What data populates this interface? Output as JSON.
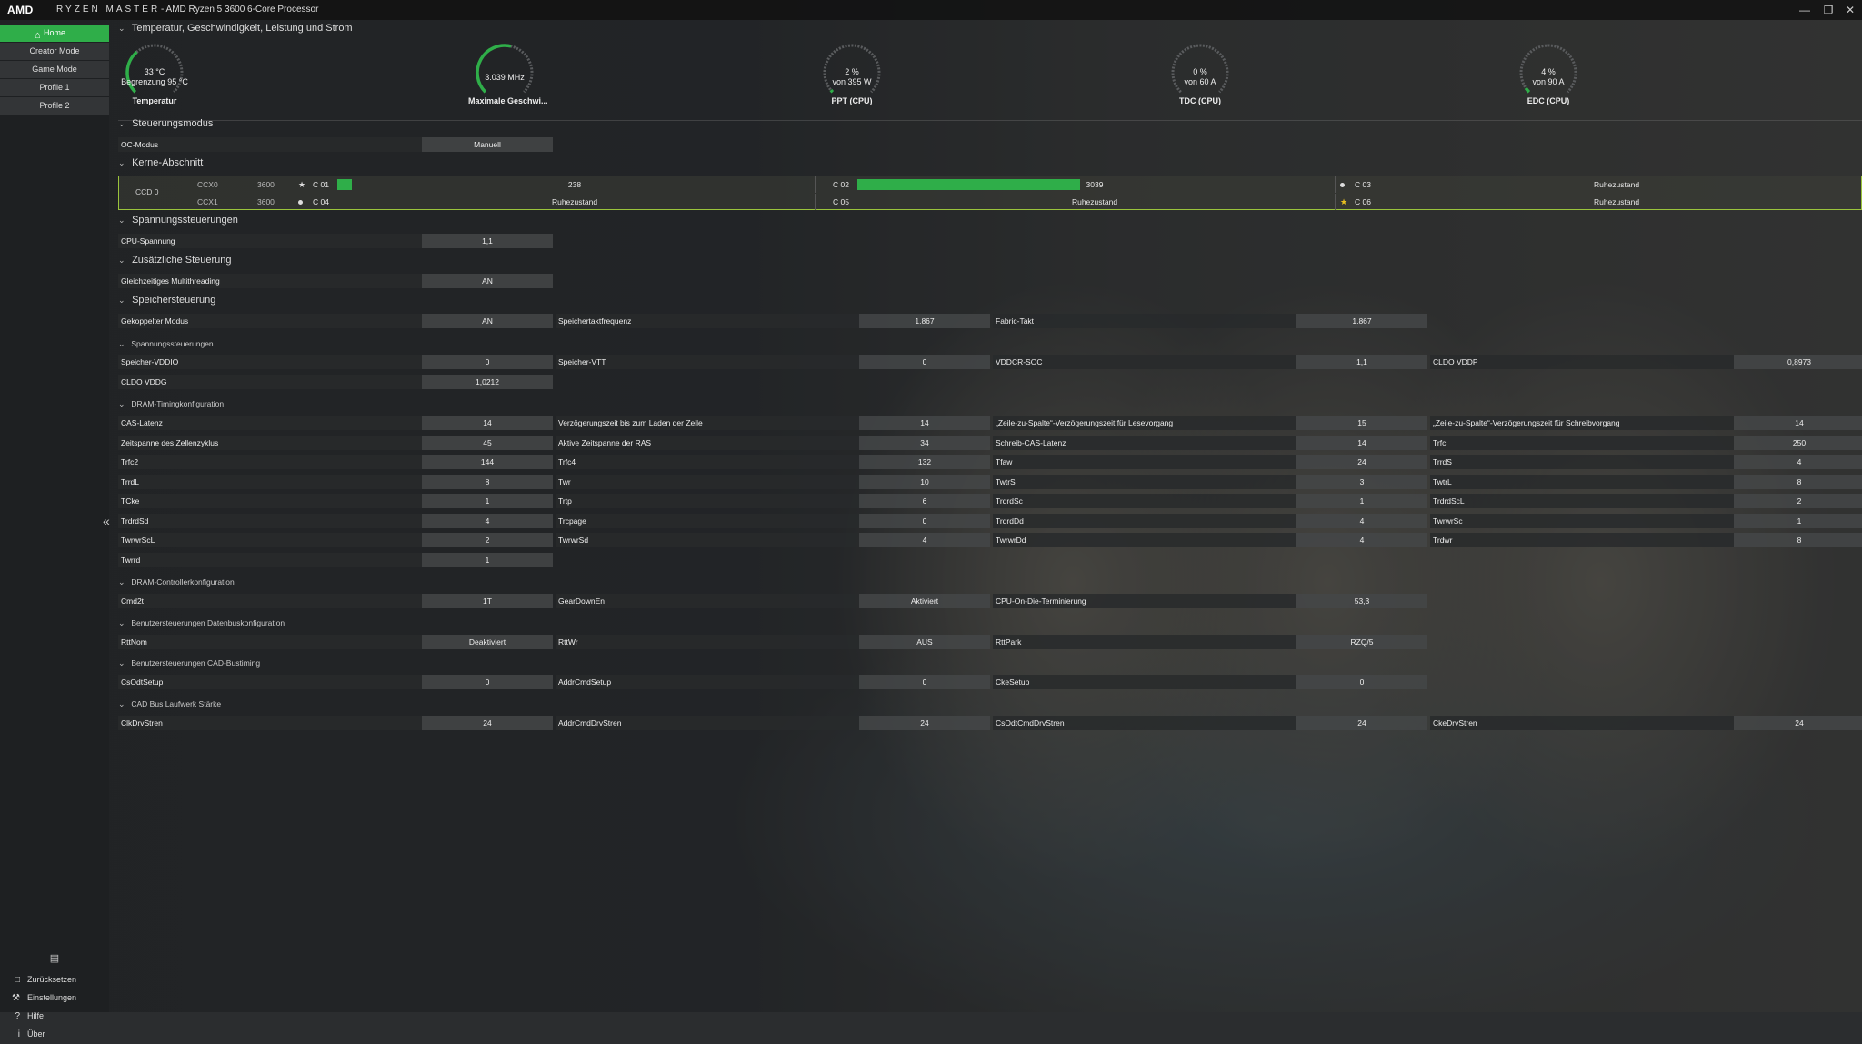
{
  "titlebar": {
    "brand": "AMD",
    "app": "RYZEN MASTER",
    "processor": "-  AMD Ryzen 5 3600 6-Core Processor"
  },
  "sidebar": {
    "items": [
      {
        "label": "Home"
      },
      {
        "label": "Creator Mode"
      },
      {
        "label": "Game Mode"
      },
      {
        "label": "Profile 1"
      },
      {
        "label": "Profile 2"
      }
    ],
    "bottom": [
      {
        "label": "Zurücksetzen"
      },
      {
        "label": "Einstellungen"
      },
      {
        "label": "Hilfe"
      },
      {
        "label": "Über"
      }
    ]
  },
  "sections": {
    "monitor": "Temperatur, Geschwindigkeit, Leistung und Strom",
    "control": "Steuerungsmodus",
    "cores": "Kerne-Abschnitt",
    "voltage": "Spannungssteuerungen",
    "additional": "Zusätzliche Steuerung",
    "memory": "Speichersteuerung",
    "mem_voltage": "Spannungssteuerungen",
    "dram_timing": "DRAM-Timingkonfiguration",
    "dram_ctrl": "DRAM-Controllerkonfiguration",
    "databus": "Benutzersteuerungen Datenbuskonfiguration",
    "cad_bus": "Benutzersteuerungen CAD-Bustiming",
    "cad_drive": "CAD Bus Laufwerk Stärke"
  },
  "gauges": [
    {
      "line1": "33 °C",
      "line2": "Begrenzung  95 °C",
      "label": "Temperatur",
      "fraction": 0.35
    },
    {
      "line1": "3.039  MHz",
      "line2": "",
      "label": "Maximale Geschwi...",
      "fraction": 0.55
    },
    {
      "line1": "2 %",
      "line2": "von  395 W",
      "label": "PPT (CPU)",
      "fraction": 0.02
    },
    {
      "line1": "0 %",
      "line2": "von  60 A",
      "label": "TDC (CPU)",
      "fraction": 0.0
    },
    {
      "line1": "4 %",
      "line2": "von  90 A",
      "label": "EDC (CPU)",
      "fraction": 0.04
    }
  ],
  "control": {
    "oc_mode_label": "OC-Modus",
    "oc_mode_value": "Manuell"
  },
  "cores": {
    "ccd": "CCD 0",
    "rows": [
      {
        "ccx": "CCX0",
        "freq": "3600",
        "cores": [
          {
            "name": "C 01",
            "value": "238",
            "bar": 0.03
          },
          {
            "name": "C 02",
            "value": "3039",
            "bar": 0.47
          },
          {
            "name": "C 03",
            "value": "Ruhezustand",
            "bar": 0
          }
        ]
      },
      {
        "ccx": "CCX1",
        "freq": "3600",
        "cores": [
          {
            "name": "C 04",
            "value": "Ruhezustand",
            "bar": 0
          },
          {
            "name": "C 05",
            "value": "Ruhezustand",
            "bar": 0
          },
          {
            "name": "C 06",
            "value": "Ruhezustand",
            "bar": 0
          }
        ]
      }
    ]
  },
  "voltage": {
    "cpu_label": "CPU-Spannung",
    "cpu_value": "1,1"
  },
  "additional": {
    "smt_label": "Gleichzeitiges Multithreading",
    "smt_value": "AN"
  },
  "memory": {
    "row1": [
      [
        "Gekoppelter Modus",
        "AN"
      ],
      [
        "Speichertaktfrequenz",
        "1.867"
      ],
      [
        "Fabric-Takt",
        "1.867"
      ]
    ],
    "voltages": [
      [
        "Speicher-VDDIO",
        "0"
      ],
      [
        "Speicher-VTT",
        "0"
      ],
      [
        "VDDCR-SOC",
        "1,1"
      ],
      [
        "CLDO VDDP",
        "0,8973"
      ]
    ],
    "voltages2": [
      [
        "CLDO VDDG",
        "1,0212"
      ]
    ],
    "timing": [
      [
        [
          "CAS-Latenz",
          "14"
        ],
        [
          "Verzögerungszeit bis zum Laden der Zeile",
          "14"
        ],
        [
          "„Zeile-zu-Spalte“-Verzögerungszeit für Lesevorgang",
          "15"
        ],
        [
          "„Zeile-zu-Spalte“-Verzögerungszeit für Schreibvorgang",
          "14"
        ]
      ],
      [
        [
          "Zeitspanne des Zellenzyklus",
          "45"
        ],
        [
          "Aktive Zeitspanne der RAS",
          "34"
        ],
        [
          "Schreib-CAS-Latenz",
          "14"
        ],
        [
          "Trfc",
          "250"
        ]
      ],
      [
        [
          "Trfc2",
          "144"
        ],
        [
          "Trfc4",
          "132"
        ],
        [
          "Tfaw",
          "24"
        ],
        [
          "TrrdS",
          "4"
        ]
      ],
      [
        [
          "TrrdL",
          "8"
        ],
        [
          "Twr",
          "10"
        ],
        [
          "TwtrS",
          "3"
        ],
        [
          "TwtrL",
          "8"
        ]
      ],
      [
        [
          "TCke",
          "1"
        ],
        [
          "Trtp",
          "6"
        ],
        [
          "TrdrdSc",
          "1"
        ],
        [
          "TrdrdScL",
          "2"
        ]
      ],
      [
        [
          "TrdrdSd",
          "4"
        ],
        [
          "Trcpage",
          "0"
        ],
        [
          "TrdrdDd",
          "4"
        ],
        [
          "TwrwrSc",
          "1"
        ]
      ],
      [
        [
          "TwrwrScL",
          "2"
        ],
        [
          "TwrwrSd",
          "4"
        ],
        [
          "TwrwrDd",
          "4"
        ],
        [
          "Trdwr",
          "8"
        ]
      ],
      [
        [
          "Twrrd",
          "1"
        ]
      ]
    ],
    "ctrl": [
      [
        "Cmd2t",
        "1T"
      ],
      [
        "GearDownEn",
        "Aktiviert"
      ],
      [
        "CPU-On-Die-Terminierung",
        "53,3"
      ]
    ],
    "databus": [
      [
        "RttNom",
        "Deaktiviert"
      ],
      [
        "RttWr",
        "AUS"
      ],
      [
        "RttPark",
        "RZQ/5"
      ]
    ],
    "cad": [
      [
        "CsOdtSetup",
        "0"
      ],
      [
        "AddrCmdSetup",
        "0"
      ],
      [
        "CkeSetup",
        "0"
      ]
    ],
    "drive": [
      [
        "ClkDrvStren",
        "24"
      ],
      [
        "AddrCmdDrvStren",
        "24"
      ],
      [
        "CsOdtCmdDrvStren",
        "24"
      ],
      [
        "CkeDrvStren",
        "24"
      ]
    ]
  }
}
